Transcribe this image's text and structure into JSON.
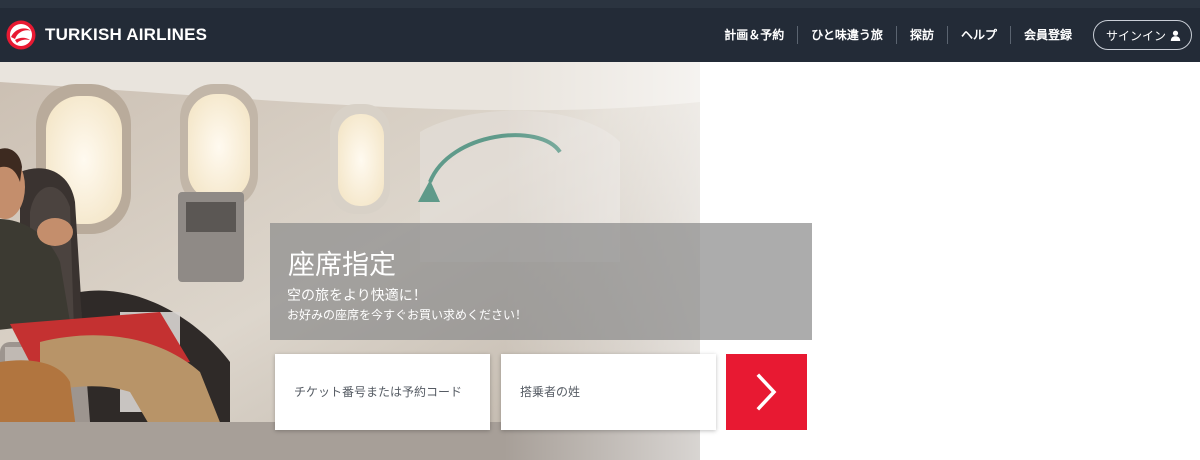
{
  "brand": {
    "name": "TURKISH AIRLINES",
    "accent": "#e81932",
    "header_bg": "#232b37"
  },
  "nav": {
    "items": [
      {
        "label": "計画＆予約"
      },
      {
        "label": "ひと味違う旅"
      },
      {
        "label": "探訪"
      },
      {
        "label": "ヘルプ"
      },
      {
        "label": "会員登録"
      }
    ],
    "signin": {
      "label": "サインイン",
      "icon": "person-icon"
    }
  },
  "promo": {
    "title": "座席指定",
    "line1": "空の旅をより快適に！",
    "line2": "お好みの座席を今すぐお買い求めください！"
  },
  "form": {
    "ticket_placeholder": "チケット番号または予約コード",
    "surname_placeholder": "搭乗者の姓",
    "submit_icon": "chevron-right-icon"
  }
}
